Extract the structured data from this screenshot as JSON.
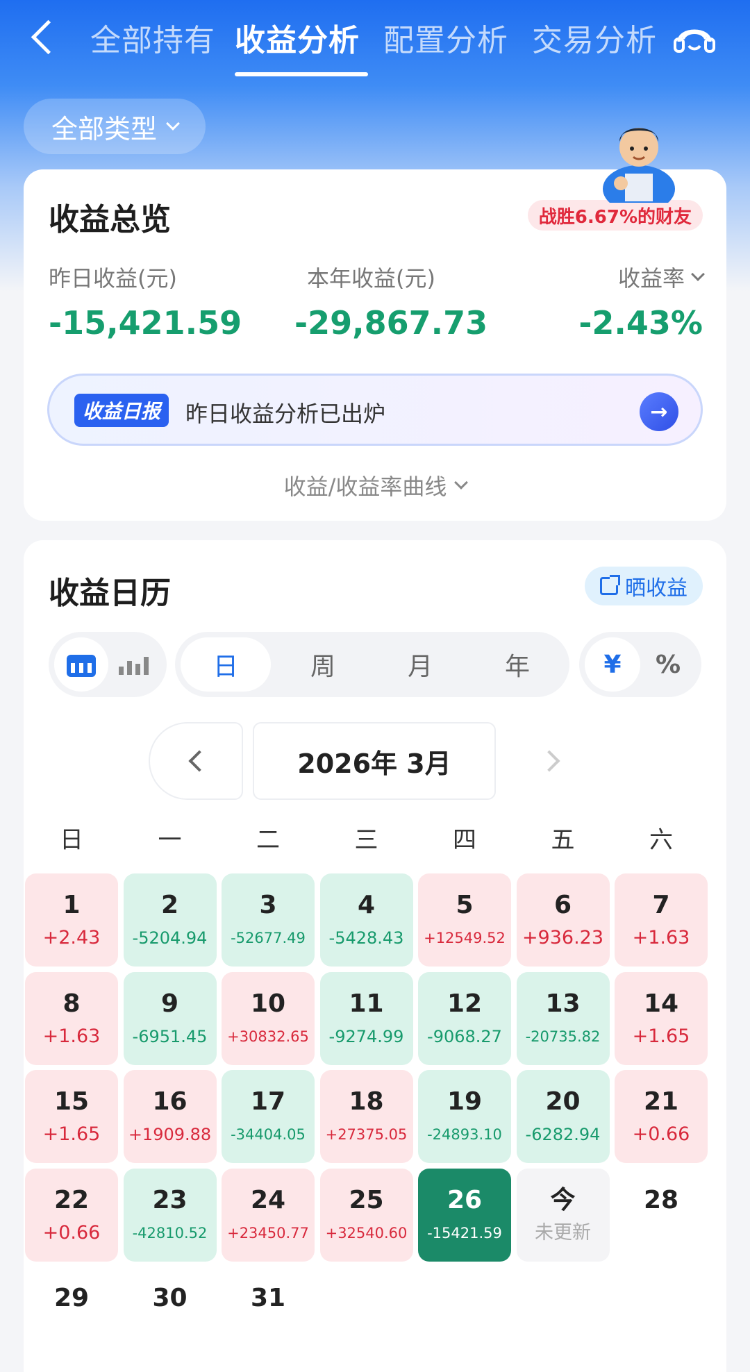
{
  "header": {
    "tabs": [
      "全部持有",
      "收益分析",
      "配置分析",
      "交易分析"
    ],
    "active_tab": 1
  },
  "filter": {
    "label": "全部类型"
  },
  "overview": {
    "title": "收益总览",
    "beat_badge": "战胜6.67%的财友",
    "yesterday_label": "昨日收益(元)",
    "yesterday_value": "-15,421.59",
    "year_label": "本年收益(元)",
    "year_value": "-29,867.73",
    "rate_label": "收益率",
    "rate_value": "-2.43%",
    "report_tag": "收益日报",
    "report_text": "昨日收益分析已出炉",
    "curve_toggle": "收益/收益率曲线"
  },
  "calendar": {
    "title": "收益日历",
    "share_label": "晒收益",
    "periods": [
      "日",
      "周",
      "月",
      "年"
    ],
    "active_period": 0,
    "units": [
      "¥",
      "%"
    ],
    "active_unit": 0,
    "month_title": "2026年 3月",
    "weekdays": [
      "日",
      "一",
      "二",
      "三",
      "四",
      "五",
      "六"
    ],
    "days": [
      {
        "day": "1",
        "value": "+2.43",
        "state": "gain"
      },
      {
        "day": "2",
        "value": "-5204.94",
        "state": "loss"
      },
      {
        "day": "3",
        "value": "-52677.49",
        "state": "loss"
      },
      {
        "day": "4",
        "value": "-5428.43",
        "state": "loss"
      },
      {
        "day": "5",
        "value": "+12549.52",
        "state": "gain"
      },
      {
        "day": "6",
        "value": "+936.23",
        "state": "gain"
      },
      {
        "day": "7",
        "value": "+1.63",
        "state": "gain"
      },
      {
        "day": "8",
        "value": "+1.63",
        "state": "gain"
      },
      {
        "day": "9",
        "value": "-6951.45",
        "state": "loss"
      },
      {
        "day": "10",
        "value": "+30832.65",
        "state": "gain"
      },
      {
        "day": "11",
        "value": "-9274.99",
        "state": "loss"
      },
      {
        "day": "12",
        "value": "-9068.27",
        "state": "loss"
      },
      {
        "day": "13",
        "value": "-20735.82",
        "state": "loss"
      },
      {
        "day": "14",
        "value": "+1.65",
        "state": "gain"
      },
      {
        "day": "15",
        "value": "+1.65",
        "state": "gain"
      },
      {
        "day": "16",
        "value": "+1909.88",
        "state": "gain"
      },
      {
        "day": "17",
        "value": "-34404.05",
        "state": "loss"
      },
      {
        "day": "18",
        "value": "+27375.05",
        "state": "gain"
      },
      {
        "day": "19",
        "value": "-24893.10",
        "state": "loss"
      },
      {
        "day": "20",
        "value": "-6282.94",
        "state": "loss"
      },
      {
        "day": "21",
        "value": "+0.66",
        "state": "gain"
      },
      {
        "day": "22",
        "value": "+0.66",
        "state": "gain"
      },
      {
        "day": "23",
        "value": "-42810.52",
        "state": "loss"
      },
      {
        "day": "24",
        "value": "+23450.77",
        "state": "gain"
      },
      {
        "day": "25",
        "value": "+32540.60",
        "state": "gain"
      },
      {
        "day": "26",
        "value": "-15421.59",
        "state": "selected"
      },
      {
        "day": "今",
        "value": "未更新",
        "state": "today"
      },
      {
        "day": "28",
        "value": "",
        "state": "none"
      },
      {
        "day": "29",
        "value": "",
        "state": "none"
      },
      {
        "day": "30",
        "value": "",
        "state": "none"
      },
      {
        "day": "31",
        "value": "",
        "state": "none"
      }
    ]
  },
  "colors": {
    "brand_blue": "#1f6ef0",
    "gain_red": "#d8293c",
    "loss_green": "#179a6c",
    "selected_green": "#1b8a68"
  }
}
